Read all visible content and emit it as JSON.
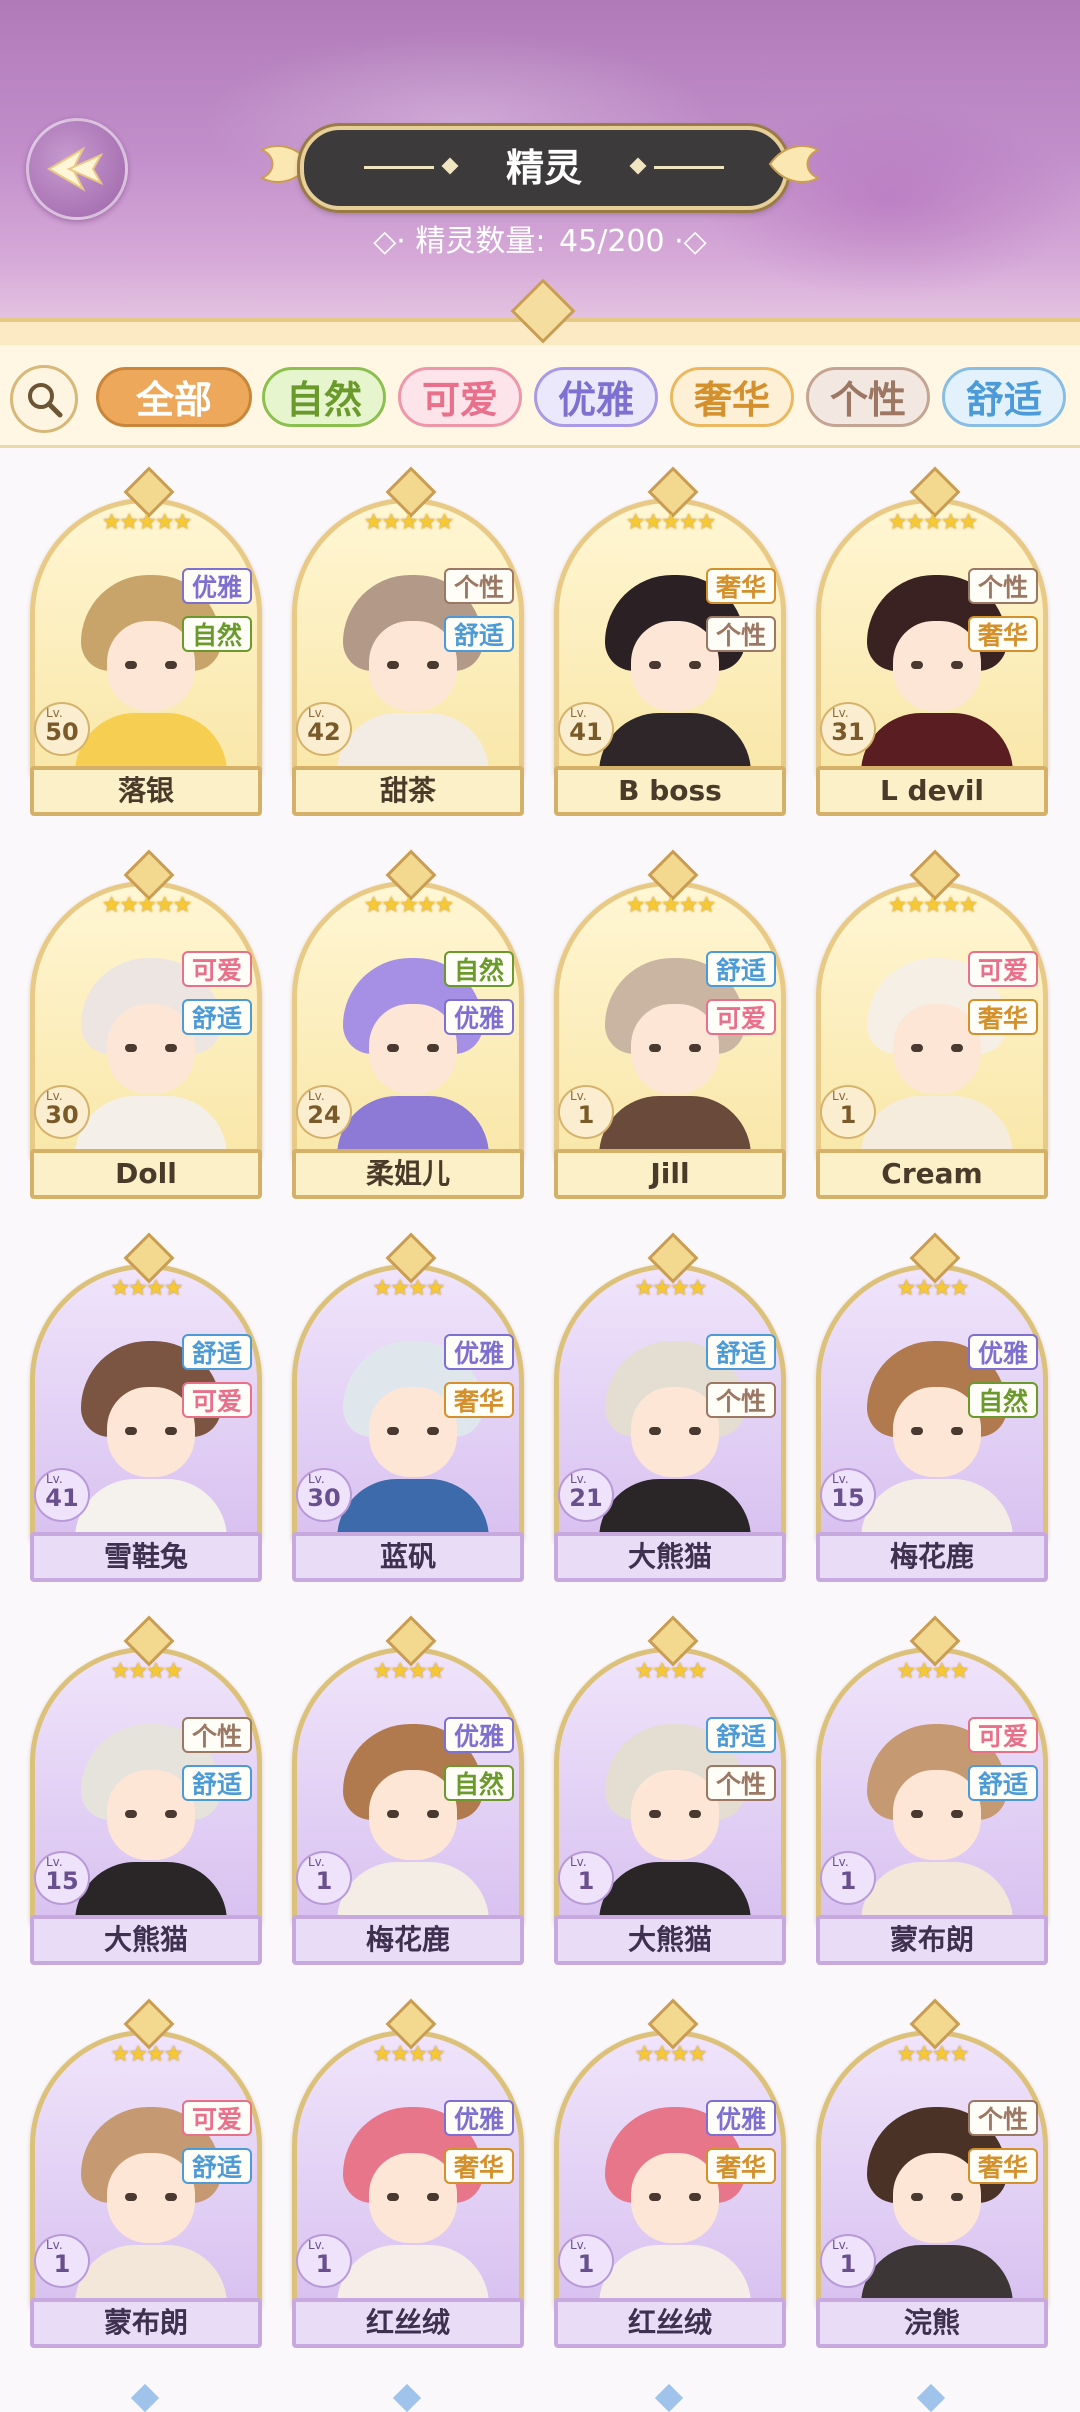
{
  "header": {
    "title": "精灵",
    "count_label": "精灵数量:",
    "count_value": "45/200"
  },
  "filters": [
    {
      "label": "全部",
      "selected": true,
      "text_color": "#ffffff",
      "bg": "#eda85b",
      "border": "#c9863a"
    },
    {
      "label": "自然",
      "selected": false,
      "text_color": "#6a9a2c",
      "bg": "#e7f5cf",
      "border": "#8cc04e"
    },
    {
      "label": "可爱",
      "selected": false,
      "text_color": "#e8708a",
      "bg": "#fde3ea",
      "border": "#ee97aa"
    },
    {
      "label": "优雅",
      "selected": false,
      "text_color": "#7d70d0",
      "bg": "#ece8fb",
      "border": "#a89ae4"
    },
    {
      "label": "奢华",
      "selected": false,
      "text_color": "#d3902c",
      "bg": "#fdf0d6",
      "border": "#ebb860"
    },
    {
      "label": "个性",
      "selected": false,
      "text_color": "#9b7764",
      "bg": "#f3e8e1",
      "border": "#c4a593"
    },
    {
      "label": "舒适",
      "selected": false,
      "text_color": "#4c9ad8",
      "bg": "#e3f1fc",
      "border": "#88bde6"
    }
  ],
  "tag_colors": {
    "优雅": "#7d70d0",
    "自然": "#6a9a2c",
    "个性": "#9b7764",
    "舒适": "#4c9ad8",
    "奢华": "#d3902c",
    "可爱": "#e8708a"
  },
  "cards": [
    {
      "name": "落银",
      "level": "50",
      "stars": "★★★★★",
      "tags": [
        "优雅",
        "自然"
      ],
      "frame": "gold",
      "hair": "#c9a46a",
      "outfit": "#f6cf52"
    },
    {
      "name": "甜茶",
      "level": "42",
      "stars": "★★★★★",
      "tags": [
        "个性",
        "舒适"
      ],
      "frame": "gold",
      "hair": "#b39a88",
      "outfit": "#f2ece4"
    },
    {
      "name": "B boss",
      "level": "41",
      "stars": "★★★★★",
      "tags": [
        "奢华",
        "个性"
      ],
      "frame": "gold",
      "hair": "#2b2024",
      "outfit": "#2e2628"
    },
    {
      "name": "L devil",
      "level": "31",
      "stars": "★★★★★",
      "tags": [
        "个性",
        "奢华"
      ],
      "frame": "gold",
      "hair": "#3a2222",
      "outfit": "#5a1e22"
    },
    {
      "name": "Doll",
      "level": "30",
      "stars": "★★★★★",
      "tags": [
        "可爱",
        "舒适"
      ],
      "frame": "gold",
      "hair": "#ece5e2",
      "outfit": "#f4efe9"
    },
    {
      "name": "柔姐儿",
      "level": "24",
      "stars": "★★★★★",
      "tags": [
        "自然",
        "优雅"
      ],
      "frame": "gold",
      "hair": "#a690e6",
      "outfit": "#8c7ad6"
    },
    {
      "name": "Jill",
      "level": "1",
      "stars": "★★★★★",
      "tags": [
        "舒适",
        "可爱"
      ],
      "frame": "gold",
      "hair": "#c9b5a2",
      "outfit": "#6a4a3a"
    },
    {
      "name": "Cream",
      "level": "1",
      "stars": "★★★★★",
      "tags": [
        "可爱",
        "奢华"
      ],
      "frame": "gold",
      "hair": "#f6efe6",
      "outfit": "#f5ecde"
    },
    {
      "name": "雪鞋兔",
      "level": "41",
      "stars": "★★★★",
      "tags": [
        "舒适",
        "可爱"
      ],
      "frame": "purple",
      "hair": "#7b5442",
      "outfit": "#f5f1ec"
    },
    {
      "name": "蓝矾",
      "level": "30",
      "stars": "★★★★",
      "tags": [
        "优雅",
        "奢华"
      ],
      "frame": "purple",
      "hair": "#dfe7ec",
      "outfit": "#3c6aaa"
    },
    {
      "name": "大熊猫",
      "level": "21",
      "stars": "★★★★",
      "tags": [
        "舒适",
        "个性"
      ],
      "frame": "purple",
      "hair": "#e4ddd1",
      "outfit": "#2a2628"
    },
    {
      "name": "梅花鹿",
      "level": "15",
      "stars": "★★★★",
      "tags": [
        "优雅",
        "自然"
      ],
      "frame": "purple",
      "hair": "#b07a4e",
      "outfit": "#f4ede6"
    },
    {
      "name": "大熊猫",
      "level": "15",
      "stars": "★★★★",
      "tags": [
        "个性",
        "舒适"
      ],
      "frame": "purple",
      "hair": "#e6e2dc",
      "outfit": "#2a2628"
    },
    {
      "name": "梅花鹿",
      "level": "1",
      "stars": "★★★★",
      "tags": [
        "优雅",
        "自然"
      ],
      "frame": "purple",
      "hair": "#b07a4e",
      "outfit": "#f4ede6"
    },
    {
      "name": "大熊猫",
      "level": "1",
      "stars": "★★★★",
      "tags": [
        "舒适",
        "个性"
      ],
      "frame": "purple",
      "hair": "#e4ddd1",
      "outfit": "#2a2628"
    },
    {
      "name": "蒙布朗",
      "level": "1",
      "stars": "★★★★",
      "tags": [
        "可爱",
        "舒适"
      ],
      "frame": "purple",
      "hair": "#c59a72",
      "outfit": "#f2e7d8"
    },
    {
      "name": "蒙布朗",
      "level": "1",
      "stars": "★★★★",
      "tags": [
        "可爱",
        "舒适"
      ],
      "frame": "purple",
      "hair": "#c59a72",
      "outfit": "#f2e7d8"
    },
    {
      "name": "红丝绒",
      "level": "1",
      "stars": "★★★★",
      "tags": [
        "优雅",
        "奢华"
      ],
      "frame": "purple",
      "hair": "#e8768a",
      "outfit": "#f6ece8"
    },
    {
      "name": "红丝绒",
      "level": "1",
      "stars": "★★★★",
      "tags": [
        "优雅",
        "奢华"
      ],
      "frame": "purple",
      "hair": "#e8768a",
      "outfit": "#f6ece8"
    },
    {
      "name": "浣熊",
      "level": "1",
      "stars": "★★★★",
      "tags": [
        "个性",
        "奢华"
      ],
      "frame": "purple",
      "hair": "#4a3226",
      "outfit": "#3c3636"
    }
  ],
  "lv_label": "Lv."
}
